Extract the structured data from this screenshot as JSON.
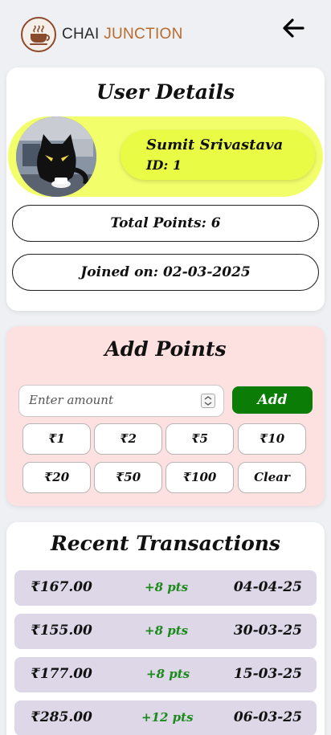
{
  "header": {
    "brand_part1": "CHAI",
    "brand_part2": "JUNCTION",
    "logo_icon": "tea-cup-icon",
    "back_icon": "arrow-left-icon"
  },
  "user_details": {
    "title": "User Details",
    "name": "Sumit Srivastava",
    "id_text": "ID: 1",
    "total_points": "Total Points: 6",
    "joined": "Joined on: 02-03-2025"
  },
  "add_points": {
    "title": "Add Points",
    "placeholder": "Enter amount",
    "add_label": "Add",
    "chips": [
      "₹1",
      "₹2",
      "₹5",
      "₹10",
      "₹20",
      "₹50",
      "₹100",
      "Clear"
    ]
  },
  "transactions": {
    "title": "Recent Transactions",
    "rows": [
      {
        "amount": "₹167.00",
        "points": "+8 pts",
        "date": "04-04-25"
      },
      {
        "amount": "₹155.00",
        "points": "+8 pts",
        "date": "30-03-25"
      },
      {
        "amount": "₹177.00",
        "points": "+8 pts",
        "date": "15-03-25"
      },
      {
        "amount": "₹285.00",
        "points": "+12 pts",
        "date": "06-03-25"
      }
    ]
  },
  "colors": {
    "accent_green": "#0b7d07",
    "user_band": "#f3ff6a",
    "add_card_bg": "#fde0e0",
    "transaction_row": "#ddd7e8",
    "brand_brown": "#b86a2d"
  }
}
